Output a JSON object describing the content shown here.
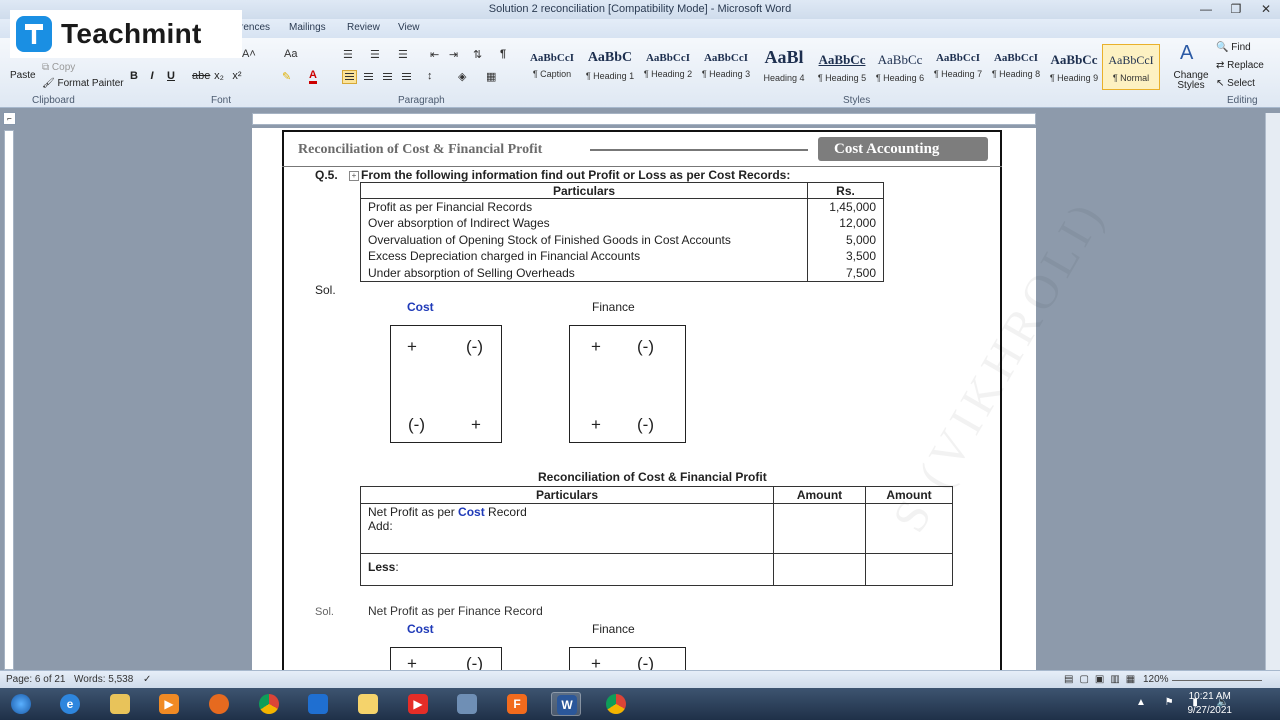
{
  "window": {
    "title": "Solution 2 reconciliation [Compatibility Mode] - Microsoft Word",
    "minimize": "—",
    "maximize": "❐",
    "close": "✕"
  },
  "ribbon_tabs": [
    "rences",
    "Mailings",
    "Review",
    "View"
  ],
  "logo": {
    "text": "Teachmint"
  },
  "clipboard": {
    "copy": "Copy",
    "format_painter": "Format Painter",
    "paste": "Paste",
    "label": "Clipboard"
  },
  "font": {
    "bold": "B",
    "italic": "I",
    "underline": "U",
    "strike": "abe",
    "subscript": "x₂",
    "superscript": "x²",
    "grow": "A˄",
    "case": "Aa",
    "label": "Font"
  },
  "paragraph": {
    "label": "Paragraph",
    "pilcrow": "¶"
  },
  "styles": {
    "label": "Styles",
    "items": [
      {
        "sample": "AaBbCcI",
        "name": "¶ Caption"
      },
      {
        "sample": "AaBbC",
        "name": "¶ Heading 1"
      },
      {
        "sample": "AaBbCcI",
        "name": "¶ Heading 2"
      },
      {
        "sample": "AaBbCcI",
        "name": "¶ Heading 3"
      },
      {
        "sample": "AaBl",
        "name": "Heading 4"
      },
      {
        "sample": "AaBbCc",
        "name": "¶ Heading 5"
      },
      {
        "sample": "AaBbCc",
        "name": "¶ Heading 6"
      },
      {
        "sample": "AaBbCcI",
        "name": "¶ Heading 7"
      },
      {
        "sample": "AaBbCcI",
        "name": "¶ Heading 8"
      },
      {
        "sample": "AaBbCc",
        "name": "¶ Heading 9"
      },
      {
        "sample": "AaBbCcI",
        "name": "¶ Normal"
      }
    ],
    "change_styles": "Change Styles"
  },
  "editing": {
    "find": "Find",
    "replace": "Replace",
    "select": "Select",
    "label": "Editing"
  },
  "document": {
    "header_left": "Reconciliation of Cost & Financial Profit",
    "header_right": "Cost Accounting",
    "question_no": "Q.5.",
    "question_text": "From the following information find out Profit or Loss as per Cost Records:",
    "table1": {
      "headers": [
        "Particulars",
        "Rs."
      ],
      "rows": [
        [
          "Profit as per Financial Records",
          "1,45,000"
        ],
        [
          "Over absorption of Indirect Wages",
          "12,000"
        ],
        [
          "Overvaluation of Opening Stock of Finished Goods in Cost Accounts",
          "5,000"
        ],
        [
          "Excess Depreciation charged in Financial Accounts",
          "3,500"
        ],
        [
          "Under absorption of Selling Overheads",
          "7,500"
        ]
      ]
    },
    "sol_label": "Sol.",
    "cost_label": "Cost",
    "finance_label": "Finance",
    "plus": "+",
    "minus": "(-)",
    "recon_title": "Reconciliation of Cost & Financial Profit",
    "table2": {
      "headers": [
        "Particulars",
        "Amount",
        "Amount"
      ],
      "net_profit_prefix": "Net Profit as per ",
      "net_profit_cost": "Cost",
      "net_profit_suffix": " Record",
      "add": "Add:",
      "less": "Less",
      "less_colon": ":"
    },
    "ghost_line": "Net Profit as per Finance Record",
    "ghost_sol": "Sol.",
    "cost_label2": "Cost",
    "finance_label2": "Finance"
  },
  "statusbar": {
    "page": "Page: 6 of 21",
    "words": "Words: 5,538",
    "zoom": "120%"
  },
  "clock": {
    "time": "10:21 AM",
    "date": "9/27/2021"
  }
}
